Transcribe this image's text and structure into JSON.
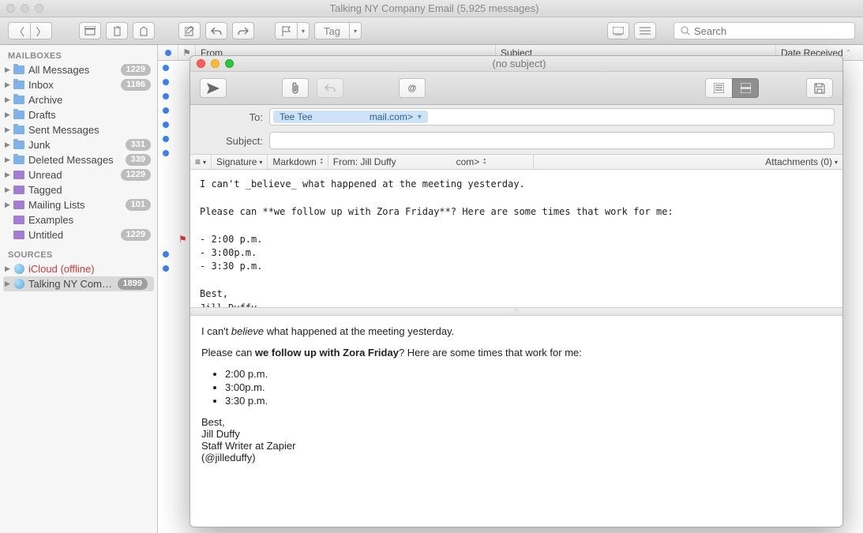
{
  "window": {
    "title": "Talking NY Company Email (5,925 messages)"
  },
  "search": {
    "placeholder": "Search"
  },
  "tag": {
    "label": "Tag"
  },
  "sidebar": {
    "mailboxes_header": "MAILBOXES",
    "sources_header": "SOURCES",
    "items": [
      {
        "label": "All Messages",
        "count": "1229",
        "icon": "folder"
      },
      {
        "label": "Inbox",
        "count": "1186",
        "icon": "folder"
      },
      {
        "label": "Archive",
        "count": "",
        "icon": "folder"
      },
      {
        "label": "Drafts",
        "count": "",
        "icon": "folder"
      },
      {
        "label": "Sent Messages",
        "count": "",
        "icon": "folder"
      },
      {
        "label": "Junk",
        "count": "331",
        "icon": "folder"
      },
      {
        "label": "Deleted Messages",
        "count": "339",
        "icon": "folder"
      },
      {
        "label": "Unread",
        "count": "1229",
        "icon": "purple"
      },
      {
        "label": "Tagged",
        "count": "",
        "icon": "purple"
      },
      {
        "label": "Mailing Lists",
        "count": "101",
        "icon": "purple"
      },
      {
        "label": "Examples",
        "count": "",
        "icon": "purple"
      },
      {
        "label": "Untitled",
        "count": "1229",
        "icon": "purple"
      }
    ],
    "sources": [
      {
        "label": "iCloud (offline)",
        "count": "",
        "offline": true
      },
      {
        "label": "Talking NY Company...",
        "count": "1899",
        "selected": true
      }
    ]
  },
  "columns": {
    "from": "From",
    "subject": "Subject",
    "date": "Date Received"
  },
  "compose": {
    "title": "(no subject)",
    "to_label": "To:",
    "subject_label": "Subject:",
    "recipient_name": "Tee Tee",
    "recipient_domain": "mail.com>",
    "signature_label": "Signature",
    "format_label": "Markdown",
    "from_label": "From: Jill Duffy",
    "from_domain": "com>",
    "attachments_label": "Attachments (0)",
    "raw_lines": {
      "l1": "I can't _believe_ what happened at the meeting yesterday.",
      "l2": "",
      "l3": "Please can **we follow up with Zora Friday**? Here are some times that work for me:",
      "l4": "",
      "l5": "- 2:00 p.m.",
      "l6": "- 3:00p.m.",
      "l7": "- 3:30 p.m.",
      "l8": "",
      "l9": "Best,",
      "l10": "Jill Duffy",
      "l11_a": "Staff Writer at ",
      "l11_b": "Zapier",
      "l12": "(@jilleduffy)"
    },
    "preview": {
      "p1a": "I can't ",
      "p1b": "believe",
      "p1c": " what happened at the meeting yesterday.",
      "p2a": "Please can ",
      "p2b": "we follow up with Zora Friday",
      "p2c": "? Here are some times that work for me:",
      "t1": "2:00 p.m.",
      "t2": "3:00p.m.",
      "t3": "3:30 p.m.",
      "s1": "Best,",
      "s2": "Jill Duffy",
      "s3": "Staff Writer at Zapier",
      "s4": "(@jilleduffy)"
    }
  }
}
